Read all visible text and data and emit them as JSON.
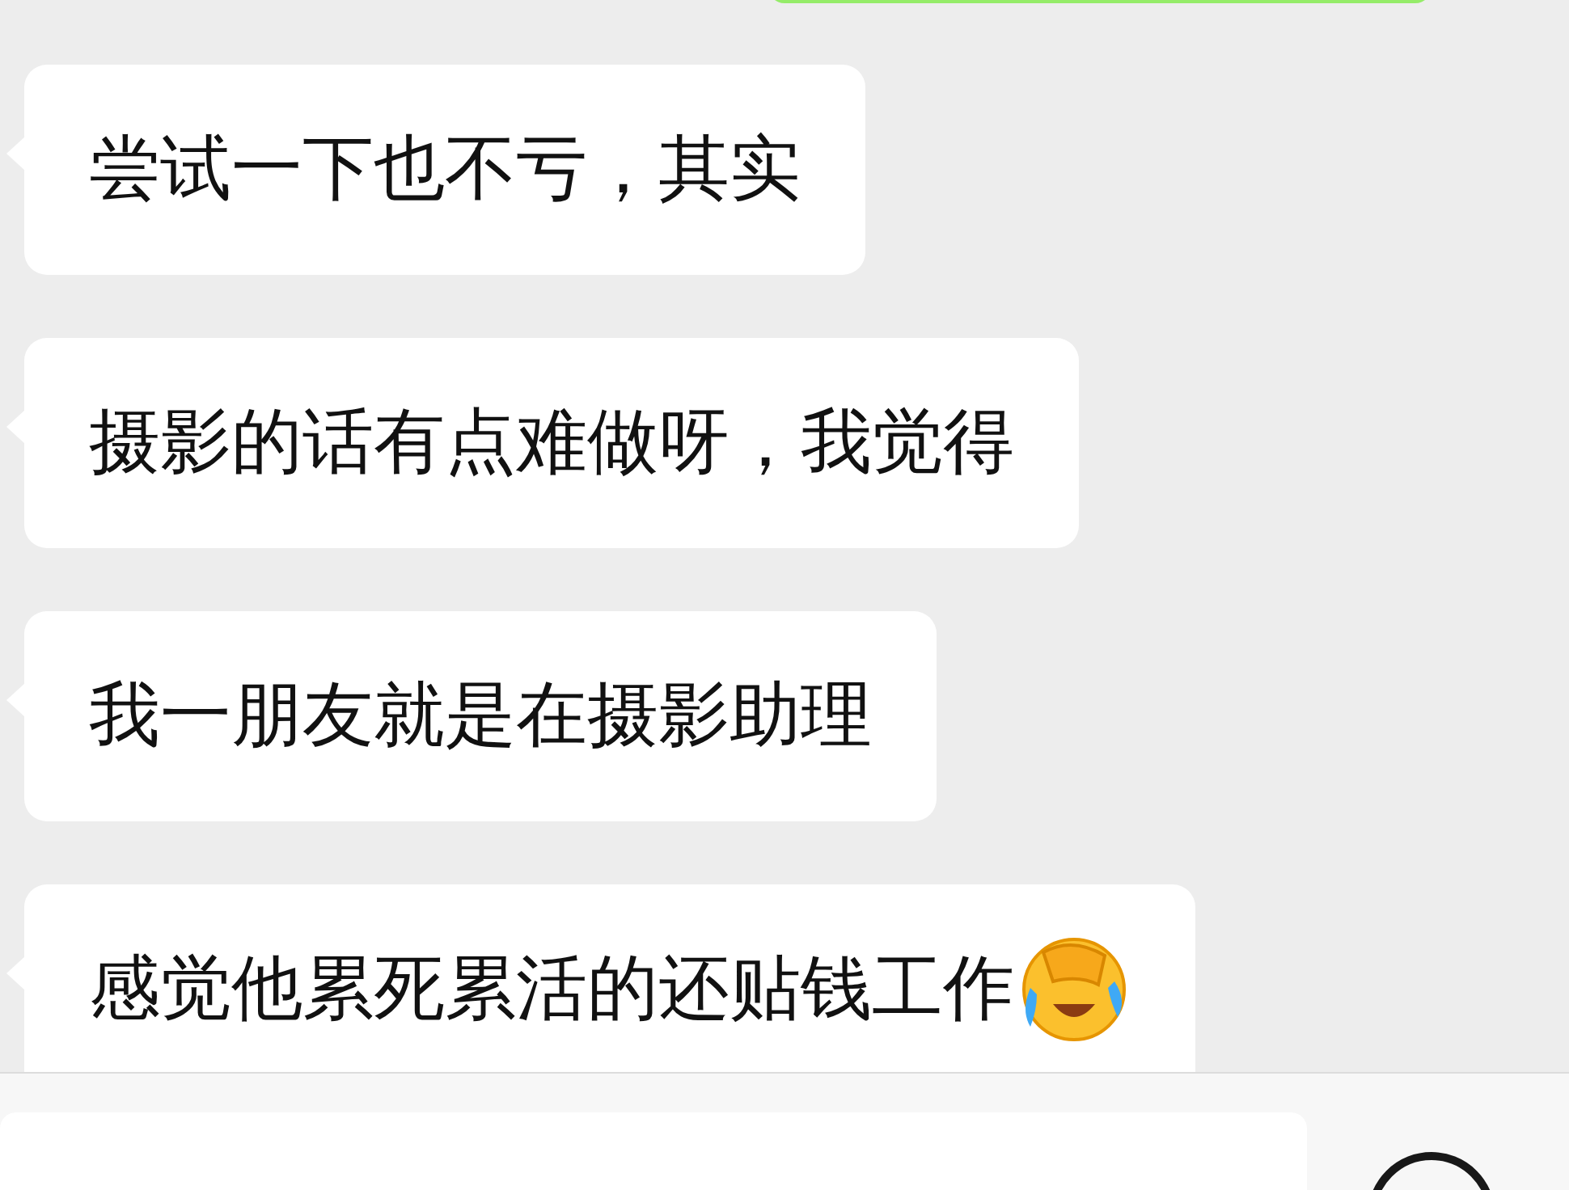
{
  "messages": [
    {
      "kind": "text",
      "text": "尝试一下也不亏，其实"
    },
    {
      "kind": "text",
      "text": "摄影的话有点难做呀，我觉得"
    },
    {
      "kind": "text",
      "text": "我一朋友就是在摄影助理"
    },
    {
      "kind": "emoji",
      "text": "感觉他累死累活的还贴钱工作"
    }
  ]
}
